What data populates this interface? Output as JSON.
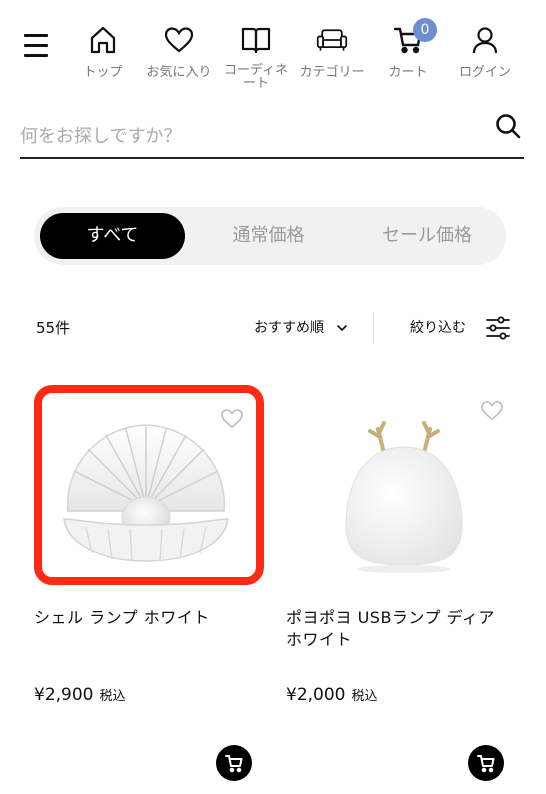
{
  "nav": {
    "items": [
      {
        "label": "トップ",
        "icon": "home-icon"
      },
      {
        "label": "お気に入り",
        "icon": "heart-icon"
      },
      {
        "label": "コーディネート",
        "icon": "book-icon"
      },
      {
        "label": "カテゴリー",
        "icon": "sofa-icon"
      },
      {
        "label": "カート",
        "icon": "cart-icon"
      },
      {
        "label": "ログイン",
        "icon": "user-icon"
      }
    ],
    "cart_count": "0"
  },
  "search": {
    "placeholder": "何をお探しですか？"
  },
  "tabs": [
    {
      "label": "すべて",
      "active": true
    },
    {
      "label": "通常価格",
      "active": false
    },
    {
      "label": "セール価格",
      "active": false
    }
  ],
  "toolbar": {
    "count": "55件",
    "sort_label": "おすすめ順",
    "filter_label": "絞り込む"
  },
  "products": [
    {
      "name": "シェル ランプ ホワイト",
      "price": "¥2,900",
      "tax_label": "税込"
    },
    {
      "name": "ポヨポヨ USBランプ ディア ホワイト",
      "price": "¥2,000",
      "tax_label": "税込"
    }
  ],
  "colors": {
    "highlight": "#ff2a14",
    "cart_badge": "#6b8fd0",
    "active_tab": "#000000"
  }
}
